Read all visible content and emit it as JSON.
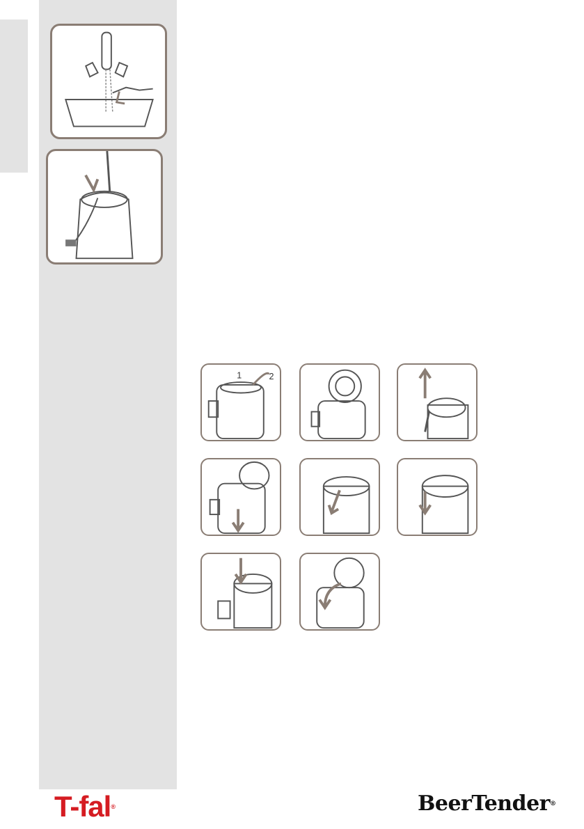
{
  "brand": {
    "left_logo": "T-fal",
    "left_logo_mark": "®",
    "right_logo": "BeerTender",
    "right_logo_mark": "®"
  },
  "figures": {
    "rinse": "faucet-rinse-illustration",
    "keg_insert": "keg-insert-illustration"
  },
  "steps": [
    {
      "labels": [
        "1",
        "2"
      ]
    },
    {
      "labels": []
    },
    {
      "labels": []
    },
    {
      "labels": []
    },
    {
      "labels": []
    },
    {
      "labels": []
    },
    {
      "labels": []
    },
    {
      "labels": []
    }
  ],
  "colors": {
    "sidebar": "#e3e3e3",
    "frame": "#8a7d74",
    "arrow": "#8a7d74",
    "tfal_red": "#d51c22"
  }
}
